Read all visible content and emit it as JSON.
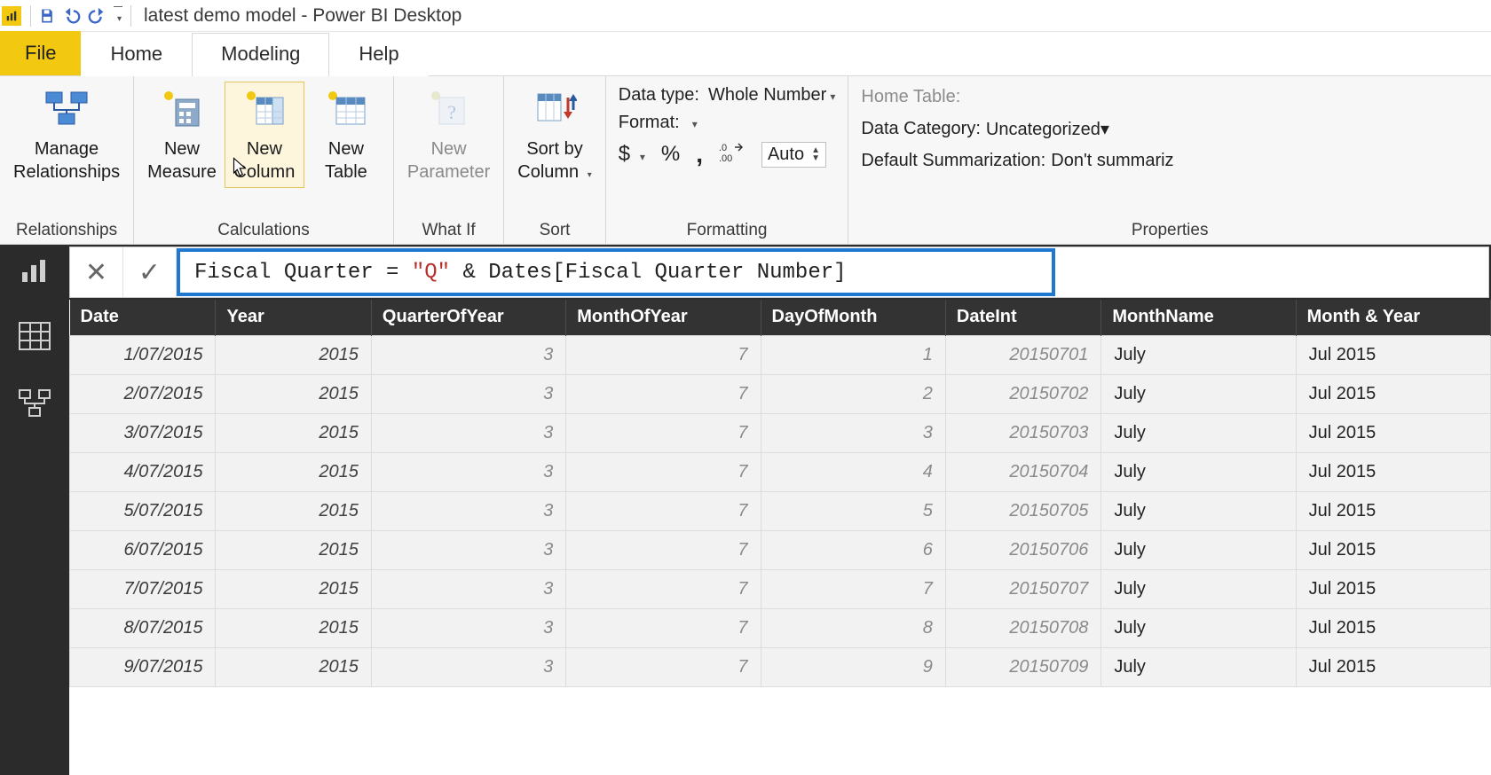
{
  "title": "latest demo model - Power BI Desktop",
  "qat": {
    "save": "save-icon",
    "undo": "undo-icon",
    "redo": "redo-icon"
  },
  "tabs": {
    "file": "File",
    "home": "Home",
    "modeling": "Modeling",
    "help": "Help",
    "active": "modeling"
  },
  "ribbon": {
    "groups": {
      "relationships": {
        "label": "Relationships",
        "manage": "Manage Relationships"
      },
      "calculations": {
        "label": "Calculations",
        "new_measure": "New Measure",
        "new_column": "New Column",
        "new_table": "New Table"
      },
      "whatif": {
        "label": "What If",
        "new_parameter": "New Parameter"
      },
      "sort": {
        "label": "Sort",
        "sort_by_column": "Sort by Column"
      },
      "formatting": {
        "label": "Formatting",
        "data_type_label": "Data type:",
        "data_type_value": "Whole Number",
        "format_label": "Format:",
        "currency": "$",
        "percent": "%",
        "comma": ",",
        "decimals_icon": ".00→.0",
        "auto": "Auto"
      },
      "properties": {
        "label": "Properties",
        "home_table_label": "Home Table:",
        "data_category_label": "Data Category:",
        "data_category_value": "Uncategorized",
        "default_summarization_label": "Default Summarization:",
        "default_summarization_value": "Don't summariz"
      }
    }
  },
  "formula": {
    "pre": "Fiscal Quarter = ",
    "str": "\"Q\"",
    "post": " & Dates[Fiscal Quarter Number]"
  },
  "columns": [
    "Date",
    "Year",
    "QuarterOfYear",
    "MonthOfYear",
    "DayOfMonth",
    "DateInt",
    "MonthName",
    "Month & Year"
  ],
  "rows": [
    {
      "Date": "1/07/2015",
      "Year": "2015",
      "QuarterOfYear": "3",
      "MonthOfYear": "7",
      "DayOfMonth": "1",
      "DateInt": "20150701",
      "MonthName": "July",
      "MonthYear": "Jul 2015"
    },
    {
      "Date": "2/07/2015",
      "Year": "2015",
      "QuarterOfYear": "3",
      "MonthOfYear": "7",
      "DayOfMonth": "2",
      "DateInt": "20150702",
      "MonthName": "July",
      "MonthYear": "Jul 2015"
    },
    {
      "Date": "3/07/2015",
      "Year": "2015",
      "QuarterOfYear": "3",
      "MonthOfYear": "7",
      "DayOfMonth": "3",
      "DateInt": "20150703",
      "MonthName": "July",
      "MonthYear": "Jul 2015"
    },
    {
      "Date": "4/07/2015",
      "Year": "2015",
      "QuarterOfYear": "3",
      "MonthOfYear": "7",
      "DayOfMonth": "4",
      "DateInt": "20150704",
      "MonthName": "July",
      "MonthYear": "Jul 2015"
    },
    {
      "Date": "5/07/2015",
      "Year": "2015",
      "QuarterOfYear": "3",
      "MonthOfYear": "7",
      "DayOfMonth": "5",
      "DateInt": "20150705",
      "MonthName": "July",
      "MonthYear": "Jul 2015"
    },
    {
      "Date": "6/07/2015",
      "Year": "2015",
      "QuarterOfYear": "3",
      "MonthOfYear": "7",
      "DayOfMonth": "6",
      "DateInt": "20150706",
      "MonthName": "July",
      "MonthYear": "Jul 2015"
    },
    {
      "Date": "7/07/2015",
      "Year": "2015",
      "QuarterOfYear": "3",
      "MonthOfYear": "7",
      "DayOfMonth": "7",
      "DateInt": "20150707",
      "MonthName": "July",
      "MonthYear": "Jul 2015"
    },
    {
      "Date": "8/07/2015",
      "Year": "2015",
      "QuarterOfYear": "3",
      "MonthOfYear": "7",
      "DayOfMonth": "8",
      "DateInt": "20150708",
      "MonthName": "July",
      "MonthYear": "Jul 2015"
    },
    {
      "Date": "9/07/2015",
      "Year": "2015",
      "QuarterOfYear": "3",
      "MonthOfYear": "7",
      "DayOfMonth": "9",
      "DateInt": "20150709",
      "MonthName": "July",
      "MonthYear": "Jul 2015"
    }
  ]
}
